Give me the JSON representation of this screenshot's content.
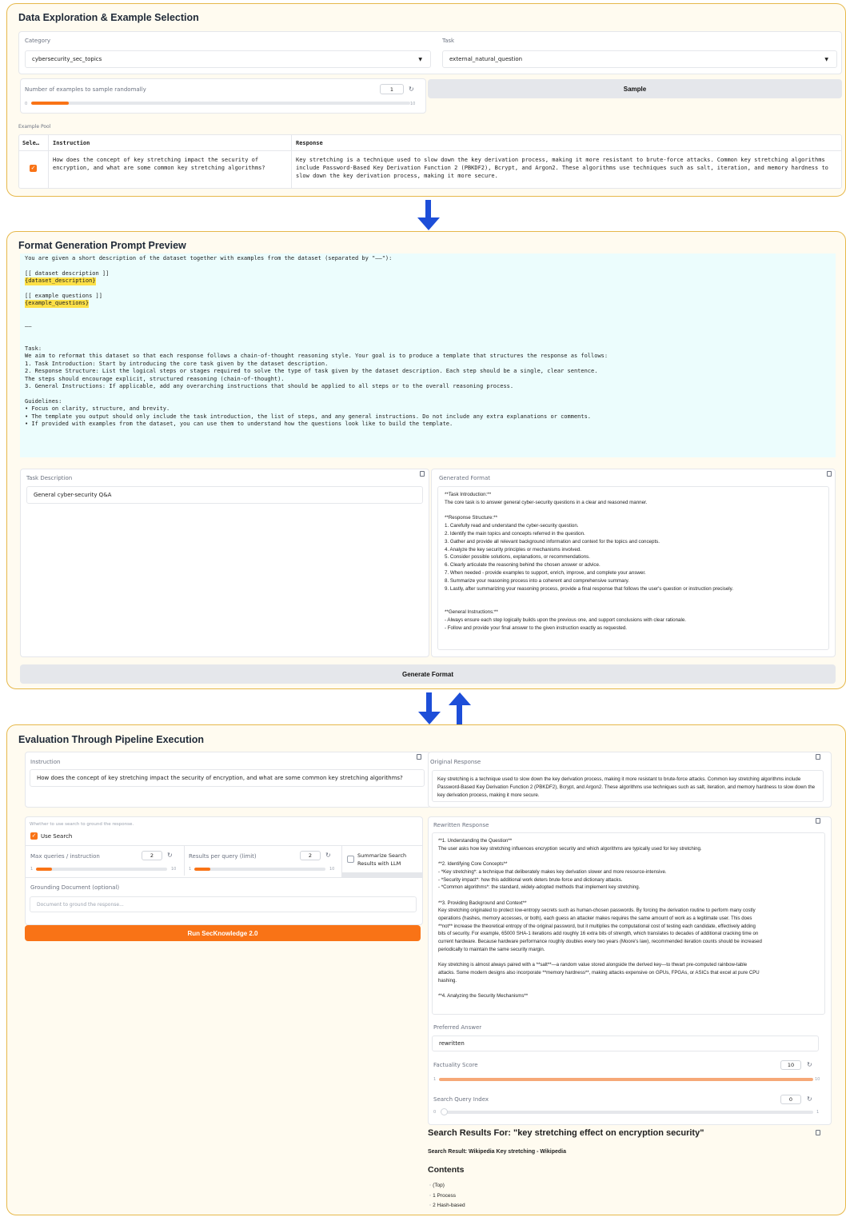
{
  "section1": {
    "title": "Data Exploration & Example Selection",
    "category_label": "Category",
    "category_value": "cybersecurity_sec_topics",
    "task_label": "Task",
    "task_value": "external_natural_question",
    "num_examples_label": "Number of examples to sample randomally",
    "num_examples_value": "1",
    "num_examples_min": "0",
    "num_examples_max": "10",
    "num_examples_fraction": 0.1,
    "sample_button": "Sample",
    "pool_label": "Example Pool",
    "table_headers": [
      "Sele…",
      "Instruction",
      "Response"
    ],
    "row_instruction": "How does the concept of key stretching impact the security of encryption, and what are some common key stretching algorithms?",
    "row_response": "Key stretching is a technique used to slow down the key derivation process, making it more resistant to brute-force attacks. Common key stretching algorithms include Password-Based Key Derivation Function 2 (PBKDF2), Bcrypt, and Argon2. These algorithms use techniques such as salt, iteration, and memory hardness to slow down the key derivation process, making it more secure.",
    "row_selected": true
  },
  "section2": {
    "title": "Format Generation Prompt Preview",
    "prompt_lines": [
      "You are given a short description of the dataset together with examples from the dataset (separated by \"——\"):",
      "",
      "[[ dataset description ]]",
      "{dataset_description}",
      "",
      "[[ example questions ]]",
      "{example_questions}",
      "",
      "",
      "——",
      "",
      "",
      "Task:",
      "We aim to reformat this dataset so that each response follows a chain-of-thought reasoning style. Your goal is to produce a template that structures the response as follows:",
      "1. Task Introduction: Start by introducing the core task given by the dataset description.",
      "2. Response Structure: List the logical steps or stages required to solve the type of task given by the dataset description. Each step should be a single, clear sentence.",
      "The steps should encourage explicit, structured reasoning (chain-of-thought).",
      "3. General Instructions: If applicable, add any overarching instructions that should be applied to all steps or to the overall reasoning process.",
      "",
      "Guidelines:",
      "• Focus on clarity, structure, and brevity.",
      "• The template you output should only include the task introduction, the list of steps, and any general instructions. Do not include any extra explanations or comments.",
      "• If provided with examples from the dataset, you can use them to understand how the questions look like to build the template."
    ],
    "highlight_lines": [
      3,
      6
    ],
    "task_desc_label": "Task Description",
    "task_desc_value": "General cyber-security Q&A",
    "gen_format_label": "Generated Format",
    "gen_format_lines": [
      "**Task Introduction:**",
      "The core task is to answer general cyber-security questions in a clear and reasoned manner.",
      "",
      "**Response Structure:**",
      "1. Carefully read and understand the cyber-security question.",
      "2. Identify the main topics and concepts referred in the question.",
      "3. Gather and provide all relevant background information and context for the topics and concepts.",
      "4. Analyze the key security principles or mechanisms involved.",
      "5. Consider possible solutions, explanations, or recommendations.",
      "6. Clearly articulate the reasoning behind the chosen answer or advice.",
      "7. When needed - provide examples to support, enrich, improve, and complete your answer.",
      "8. Summarize your reasoning process into a coherent and comprehensive summary.",
      "9. Lastly, after summarizing your reasoning process, provide a final response that follows the user's question or instruction precisely.",
      "",
      "",
      "**General Instructions:**",
      "- Always ensure each step logically builds upon the previous one, and support conclusions with clear rationale.",
      "- Follow and provide your final answer to the given instruction exactly as requested."
    ],
    "generate_button": "Generate Format"
  },
  "section3": {
    "title": "Evaluation Through Pipeline Execution",
    "instruction_label": "Instruction",
    "instruction_value": "How does the concept of key stretching impact the security of encryption, and what are some common key stretching algorithms?",
    "orig_label": "Original Response",
    "orig_value": "Key stretching is a technique used to slow down the key derivation process, making it more resistant to brute-force attacks. Common key stretching algorithms include Password-Based Key Derivation Function 2 (PBKDF2), Bcrypt, and Argon2. These algorithms use techniques such as salt, iteration, and memory hardness to slow down the key derivation process, making it more secure.",
    "search_hint": "Whether to use search to ground the response.",
    "use_search_label": "Use Search",
    "use_search_checked": true,
    "max_q_label": "Max queries / instruction",
    "max_q_value": "2",
    "max_q_min": "1",
    "max_q_max": "10",
    "max_q_fraction": 0.12,
    "results_label": "Results per query (limit)",
    "results_value": "2",
    "results_min": "1",
    "results_max": "10",
    "results_fraction": 0.12,
    "summarize_label": "Summarize Search Results with LLM",
    "summarize_checked": false,
    "grounding_label": "Grounding Document (optional)",
    "grounding_placeholder": "Document to ground the response...",
    "run_button": "Run SecKnowledge 2.0",
    "rewritten_label": "Rewritten Response",
    "rewritten_lines": [
      "**1. Understanding the Question**",
      "The user asks how key stretching influences encryption security and which algorithms are typically used for key stretching.",
      "",
      "**2. Identifying Core Concepts**",
      "- *Key stretching*: a technique that deliberately makes key derivation slower and more resource-intensive.",
      "- *Security impact*: how this additional work deters brute-force and dictionary attacks.",
      "- *Common algorithms*: the standard, widely-adopted methods that implement key stretching.",
      "",
      "**3. Providing Background and Context**",
      "Key stretching originated to protect low-entropy secrets such as human-chosen passwords. By forcing the derivation routine to perform many costly",
      "operations (hashes, memory accesses, or both), each guess an attacker makes requires the same amount of work as a legitimate user. This does",
      "**not** increase the theoretical entropy of the original password, but it multiplies the computational cost of testing each candidate, effectively adding",
      "bits of security. For example, 65000 SHA-1 iterations add roughly 16 extra bits of strength, which translates to decades of additional cracking time on",
      "current hardware. Because hardware performance roughly doubles every two years (Moore's law), recommended iteration counts should be increased",
      "periodically to maintain the same security margin.",
      "",
      "Key stretching is almost always paired with a **salt**—a random value stored alongside the derived key—to thwart pre-computed rainbow-table",
      "attacks. Some modern designs also incorporate **memory hardness**, making attacks expensive on GPUs, FPGAs, or ASICs that excel at pure CPU",
      "hashing.",
      "",
      "**4. Analyzing the Security Mechanisms**"
    ],
    "preferred_label": "Preferred Answer",
    "preferred_value": "rewritten",
    "factuality_label": "Factuality Score",
    "factuality_value": "10",
    "factuality_min": "1",
    "factuality_max": "10",
    "factuality_fraction": 1.0,
    "sqi_label": "Search Query Index",
    "sqi_value": "0",
    "sqi_min": "0",
    "sqi_max": "1",
    "sqi_fraction": 0.0,
    "search_results_title": "Search Results For: \"key stretching effect on encryption security\"",
    "search_result_line": "Search Result: Wikipedia Key stretching - Wikipedia",
    "contents_heading": "Contents",
    "contents_items": [
      "(Top)",
      "1 Process",
      "2 Hash-based"
    ]
  },
  "colors": {
    "accent": "#f97316",
    "panel_border": "#e6b84a",
    "panel_bg": "#fffbf0",
    "prompt_bg": "#ecfdfd",
    "highlight": "#fde047",
    "arrow": "#1d4ed8"
  },
  "icons": [
    "dropdown-caret-icon",
    "reset-icon",
    "checkbox-checked-icon",
    "copy-icon",
    "down-arrow-icon",
    "up-arrow-icon"
  ]
}
